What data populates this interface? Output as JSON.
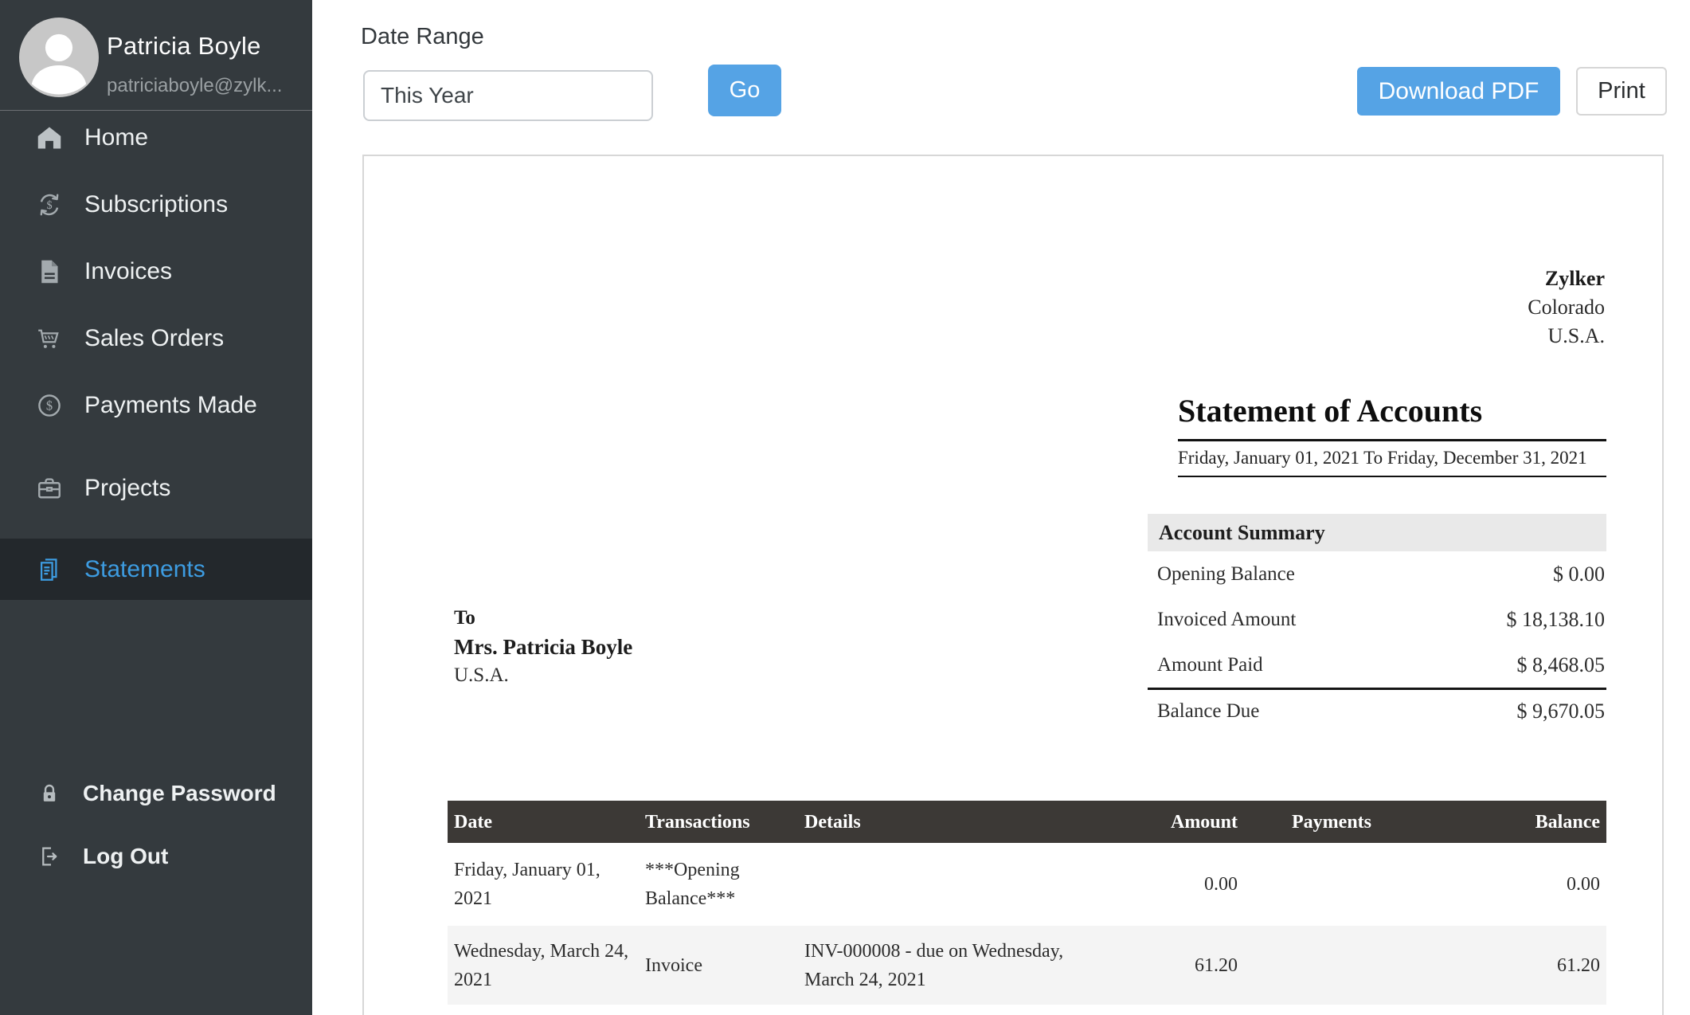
{
  "sidebar": {
    "user": {
      "name": "Patricia Boyle",
      "email": "patriciaboyle@zylk..."
    },
    "items": [
      {
        "label": "Home",
        "icon": "home-icon",
        "active": false
      },
      {
        "label": "Subscriptions",
        "icon": "subscriptions-icon",
        "active": false
      },
      {
        "label": "Invoices",
        "icon": "invoices-icon",
        "active": false
      },
      {
        "label": "Sales Orders",
        "icon": "sales-orders-icon",
        "active": false
      },
      {
        "label": "Payments Made",
        "icon": "payments-made-icon",
        "active": false
      },
      {
        "label": "Projects",
        "icon": "projects-icon",
        "active": false
      },
      {
        "label": "Statements",
        "icon": "statements-icon",
        "active": true
      }
    ],
    "footer_items": [
      {
        "label": "Change Password",
        "icon": "lock-icon"
      },
      {
        "label": "Log Out",
        "icon": "logout-icon"
      }
    ]
  },
  "toolbar": {
    "date_range_label": "Date Range",
    "date_range_value": "This Year",
    "go_label": "Go",
    "download_pdf_label": "Download PDF",
    "print_label": "Print"
  },
  "statement": {
    "company": {
      "name": "Zylker",
      "region": "Colorado",
      "country": "U.S.A."
    },
    "title": "Statement of Accounts",
    "period": "Friday, January 01, 2021 To Friday, December 31, 2021",
    "to_label": "To",
    "recipient": "Mrs. Patricia Boyle",
    "recipient_country": "U.S.A.",
    "account_summary": {
      "title": "Account Summary",
      "rows": [
        {
          "label": "Opening Balance",
          "value": "$ 0.00"
        },
        {
          "label": "Invoiced Amount",
          "value": "$ 18,138.10"
        },
        {
          "label": "Amount Paid",
          "value": "$ 8,468.05"
        }
      ],
      "total": {
        "label": "Balance Due",
        "value": "$ 9,670.05"
      }
    },
    "transactions": {
      "headers": [
        "Date",
        "Transactions",
        "Details",
        "Amount",
        "Payments",
        "Balance"
      ],
      "rows": [
        {
          "date": "Friday, January 01, 2021",
          "transaction": "***Opening Balance***",
          "details": "",
          "amount": "0.00",
          "payments": "",
          "balance": "0.00"
        },
        {
          "date": "Wednesday, March 24, 2021",
          "transaction": "Invoice",
          "details": "INV-000008 - due on Wednesday, March 24, 2021",
          "amount": "61.20",
          "payments": "",
          "balance": "61.20"
        }
      ]
    }
  },
  "colors": {
    "accent": "#55a3e5",
    "link": "#3d9ce1",
    "sidebar-bg": "#343a3e",
    "sidebar-active-bg": "#23282c",
    "table-header-bg": "#3c3936",
    "summary-header-bg": "#e9e9e9",
    "row-alt-bg": "#f4f4f4"
  }
}
